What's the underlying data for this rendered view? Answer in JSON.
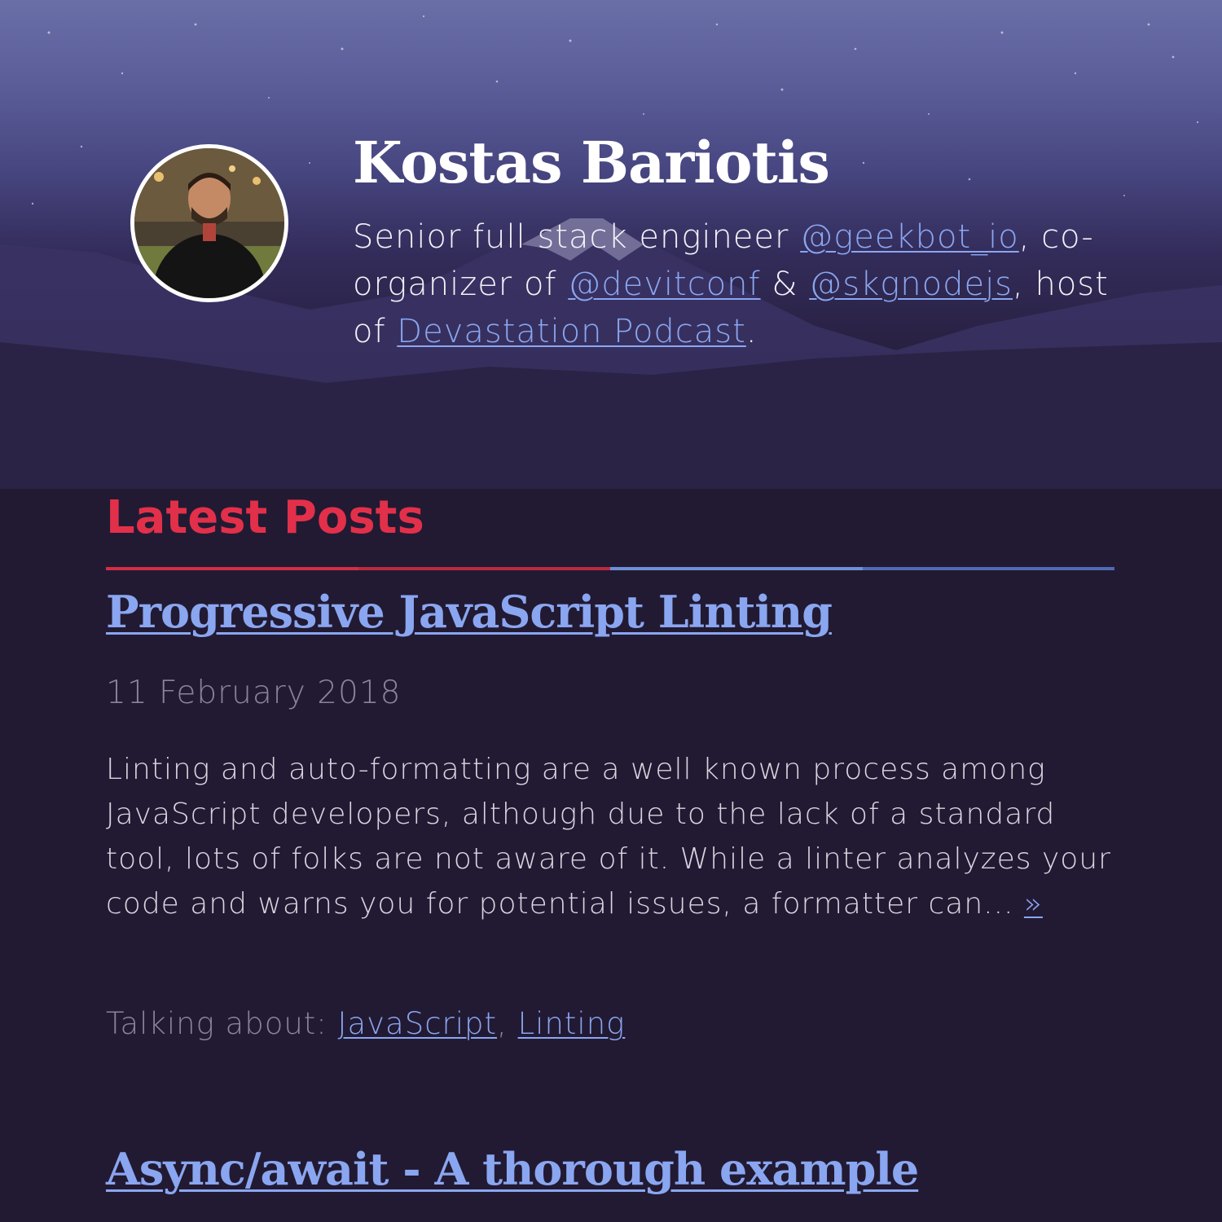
{
  "header": {
    "name": "Kostas Bariotis",
    "bio": {
      "prefix": "Senior full stack engineer ",
      "link_geekbot": "@geekbot_io",
      "between_1": ", co-organizer of ",
      "link_devitconf": "@devitconf",
      "between_2": " & ",
      "link_skgnodejs": "@skgnodejs",
      "between_3": ", host of ",
      "link_podcast": "Devastation Podcast",
      "suffix": "."
    }
  },
  "section": {
    "title": "Latest Posts",
    "divider_colors": [
      "#d12f45",
      "#b92a3e",
      "#6f8fd6",
      "#4f6bb3"
    ]
  },
  "posts": [
    {
      "title": "Progressive JavaScript Linting",
      "date": "11 February 2018",
      "excerpt": "Linting and auto-formatting are a well known process among JavaScript developers, although due to the lack of a standard tool, lots of folks are not aware of it. While a linter analyzes your code and warns you for potential issues, a formatter can... ",
      "read_more": "»",
      "tags_label": "Talking about: ",
      "tags": [
        "JavaScript",
        "Linting"
      ],
      "tag_separator": ", "
    },
    {
      "title": "Async/await - A thorough example"
    }
  ],
  "colors": {
    "background": "#221a33",
    "accent_red": "#e2304a",
    "link_blue": "#8aa6f0",
    "muted_text": "#8b8498"
  },
  "icons": {
    "avatar": "profile-photo"
  }
}
